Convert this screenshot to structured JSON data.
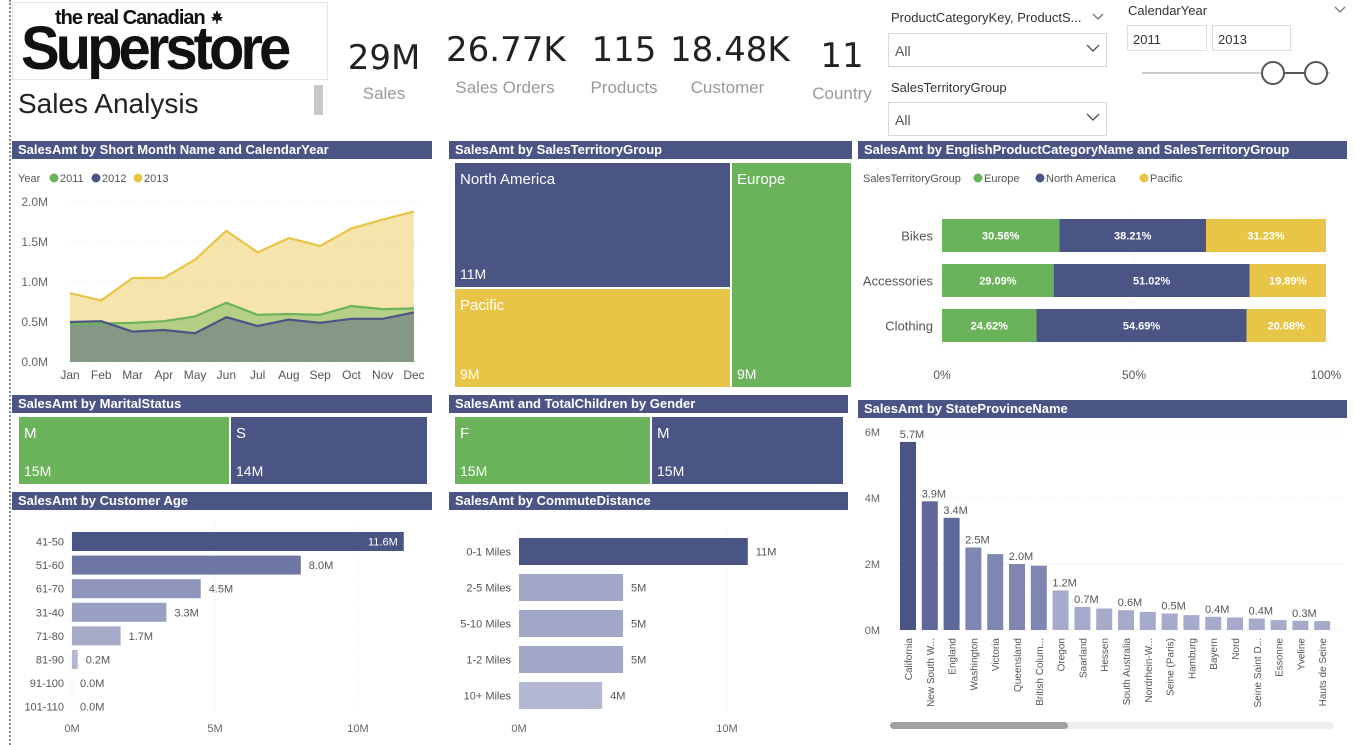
{
  "logo": {
    "line1": "the real Canadian",
    "line2": "Superstore"
  },
  "page_title": "Sales Analysis",
  "kpis": [
    {
      "value": "29M",
      "label": "Sales"
    },
    {
      "value": "26.77K",
      "label": "Sales Orders"
    },
    {
      "value": "115",
      "label": "Products"
    },
    {
      "value": "18.48K",
      "label": "Customer"
    },
    {
      "value": "11",
      "label": "Country"
    }
  ],
  "slicers": {
    "product": {
      "title": "ProductCategoryKey, ProductS...",
      "value": "All"
    },
    "territory": {
      "title": "SalesTerritoryGroup",
      "value": "All"
    },
    "year": {
      "title": "CalendarYear",
      "from": "2011",
      "to": "2013"
    }
  },
  "colors": {
    "green": "#6bb35a",
    "navy": "#4a5585",
    "yellow": "#e8c547",
    "light": "#8e94bb"
  },
  "chart_data": [
    {
      "id": "month_year",
      "type": "area",
      "title": "SalesAmt by Short Month Name and CalendarYear",
      "legend_title": "Year",
      "categories": [
        "Jan",
        "Feb",
        "Mar",
        "Apr",
        "May",
        "Jun",
        "Jul",
        "Aug",
        "Sep",
        "Oct",
        "Nov",
        "Dec"
      ],
      "yticks": [
        "2.0M",
        "1.5M",
        "1.0M",
        "0.5M",
        "0.0M"
      ],
      "ylim": [
        0,
        2.0
      ],
      "series": [
        {
          "name": "2011",
          "color": "#6bb35a",
          "values": [
            0.47,
            0.48,
            0.49,
            0.51,
            0.57,
            0.74,
            0.59,
            0.6,
            0.59,
            0.7,
            0.66,
            0.67
          ]
        },
        {
          "name": "2012",
          "color": "#4a5585",
          "values": [
            0.5,
            0.51,
            0.38,
            0.4,
            0.36,
            0.56,
            0.45,
            0.53,
            0.49,
            0.54,
            0.54,
            0.62
          ]
        },
        {
          "name": "2013",
          "color": "#e8c547",
          "values": [
            0.86,
            0.77,
            1.05,
            1.05,
            1.28,
            1.64,
            1.37,
            1.55,
            1.45,
            1.67,
            1.78,
            1.88
          ]
        }
      ]
    },
    {
      "id": "territory",
      "type": "treemap",
      "title": "SalesAmt by SalesTerritoryGroup",
      "items": [
        {
          "name": "North America",
          "label": "11M",
          "value": 11,
          "color": "#4a5585"
        },
        {
          "name": "Pacific",
          "label": "9M",
          "value": 9,
          "color": "#e8c547"
        },
        {
          "name": "Europe",
          "label": "9M",
          "value": 9,
          "color": "#6bb35a"
        }
      ]
    },
    {
      "id": "category_territory",
      "type": "bar",
      "stacked": "100%",
      "title": "SalesAmt by EnglishProductCategoryName and SalesTerritoryGroup",
      "legend_title": "SalesTerritoryGroup",
      "categories": [
        "Bikes",
        "Accessories",
        "Clothing"
      ],
      "series": [
        {
          "name": "Europe",
          "color": "#6bb35a",
          "values": [
            30.56,
            29.09,
            24.62
          ],
          "labels": [
            "30.56%",
            "29.09%",
            "24.62%"
          ]
        },
        {
          "name": "North America",
          "color": "#4a5585",
          "values": [
            38.21,
            51.02,
            54.69
          ],
          "labels": [
            "38.21%",
            "51.02%",
            "54.69%"
          ]
        },
        {
          "name": "Pacific",
          "color": "#e8c547",
          "values": [
            31.23,
            19.89,
            20.68
          ],
          "labels": [
            "31.23%",
            "19.89%",
            "20.68%"
          ]
        }
      ],
      "xticks": [
        "0%",
        "50%",
        "100%"
      ]
    },
    {
      "id": "marital",
      "type": "treemap",
      "title": "SalesAmt by MaritalStatus",
      "items": [
        {
          "name": "M",
          "label": "15M",
          "value": 15,
          "color": "#6bb35a"
        },
        {
          "name": "S",
          "label": "14M",
          "value": 14,
          "color": "#4a5585"
        }
      ]
    },
    {
      "id": "gender",
      "type": "treemap",
      "title": "SalesAmt and TotalChildren by Gender",
      "items": [
        {
          "name": "F",
          "label": "15M",
          "value": 15,
          "color": "#6bb35a"
        },
        {
          "name": "M",
          "label": "15M",
          "value": 15,
          "color": "#4a5585"
        }
      ]
    },
    {
      "id": "age",
      "type": "bar",
      "orientation": "horizontal",
      "title": "SalesAmt by Customer Age",
      "categories": [
        "41-50",
        "51-60",
        "61-70",
        "31-40",
        "71-80",
        "81-90",
        "91-100",
        "101-110"
      ],
      "values": [
        11.6,
        8.0,
        4.5,
        3.3,
        1.7,
        0.2,
        0.0,
        0.0
      ],
      "labels": [
        "11.6M",
        "8.0M",
        "4.5M",
        "3.3M",
        "1.7M",
        "0.2M",
        "0.0M",
        "0.0M"
      ],
      "xticks": [
        "0M",
        "5M",
        "10M"
      ],
      "xlim": [
        0,
        10
      ]
    },
    {
      "id": "commute",
      "type": "bar",
      "orientation": "horizontal",
      "title": "SalesAmt by CommuteDistance",
      "categories": [
        "0-1 Miles",
        "2-5 Miles",
        "5-10 Miles",
        "1-2 Miles",
        "10+ Miles"
      ],
      "values": [
        11,
        5,
        5,
        5,
        4
      ],
      "labels": [
        "11M",
        "5M",
        "5M",
        "5M",
        "4M"
      ],
      "xticks": [
        "0M",
        "10M"
      ],
      "xlim": [
        0,
        10
      ]
    },
    {
      "id": "state",
      "type": "bar",
      "orientation": "vertical",
      "title": "SalesAmt by StateProvinceName",
      "categories": [
        "California",
        "New South W...",
        "England",
        "Washington",
        "Victoria",
        "Queensland",
        "British Colum...",
        "Oregon",
        "Saarland",
        "Hessen",
        "South Australia",
        "Nordrhein-W...",
        "Seine (Paris)",
        "Hamburg",
        "Bayern",
        "Nord",
        "Seine Saint D...",
        "Essonne",
        "Yveline",
        "Hauts de Seine"
      ],
      "values": [
        5.7,
        3.9,
        3.4,
        2.5,
        2.3,
        2.0,
        1.95,
        1.2,
        0.7,
        0.65,
        0.6,
        0.55,
        0.5,
        0.45,
        0.4,
        0.38,
        0.35,
        0.3,
        0.28,
        0.27
      ],
      "labels": [
        "5.7M",
        "3.9M",
        "3.4M",
        "2.5M",
        "",
        "2.0M",
        "",
        "1.2M",
        "0.7M",
        "",
        "0.6M",
        "",
        "0.5M",
        "",
        "0.4M",
        "",
        "0.4M",
        "",
        "0.3M",
        ""
      ],
      "yticks": [
        "6M",
        "4M",
        "2M",
        "0M"
      ],
      "ylim": [
        0,
        6
      ]
    }
  ]
}
